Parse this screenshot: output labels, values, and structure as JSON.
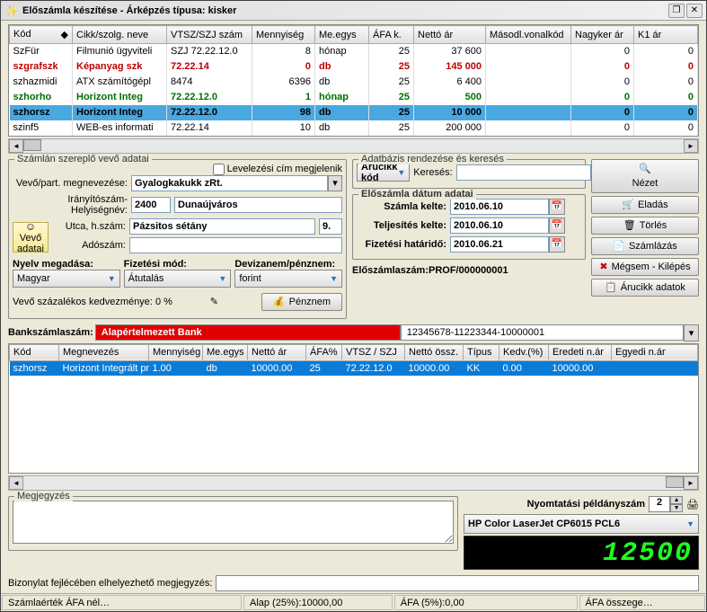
{
  "window": {
    "title": "Előszámla készítése - Árképzés típusa: kisker"
  },
  "grid1": {
    "cols": [
      "Kód",
      "Cikk/szolg. neve",
      "VTSZ/SZJ szám",
      "Mennyiség",
      "Me.egys",
      "ÁFA k.",
      "Nettó ár",
      "Másodl.vonalkód",
      "Nagyker ár",
      "K1 ár"
    ],
    "rows": [
      {
        "c": [
          "SzFür",
          "Filmunió ügyviteli",
          "SZJ 72.22.12.0",
          "8",
          "hónap",
          "25",
          "37 600",
          "",
          "0",
          "0"
        ],
        "cls": ""
      },
      {
        "c": [
          "szgrafszk",
          "Képanyag szk",
          "72.22.14",
          "0",
          "db",
          "25",
          "145 000",
          "",
          "0",
          "0"
        ],
        "cls": "red"
      },
      {
        "c": [
          "szhazmidi",
          "ATX számítógépl",
          "8474",
          "6396",
          "db",
          "25",
          "6 400",
          "",
          "0",
          "0"
        ],
        "cls": ""
      },
      {
        "c": [
          "szhorho",
          "Horizont Integ",
          "72.22.12.0",
          "1",
          "hónap",
          "25",
          "500",
          "",
          "0",
          "0"
        ],
        "cls": "green"
      },
      {
        "c": [
          "szhorsz",
          "Horizont Integ",
          "72.22.12.0",
          "98",
          "db",
          "25",
          "10 000",
          "",
          "0",
          "0"
        ],
        "cls": "sel"
      },
      {
        "c": [
          "szinf5",
          "WEB-es informati",
          "72.22.14",
          "10",
          "db",
          "25",
          "200 000",
          "",
          "0",
          "0"
        ],
        "cls": ""
      }
    ]
  },
  "buyer": {
    "legend": "Számlán szereplő vevő adatai",
    "mail_chk": "Levelezési cím megjelenik",
    "l_name": "Vevő/part. megnevezése:",
    "name": "Gyalogkakukk zRt.",
    "l_zip": "Irányítószám-Helyiségnév:",
    "zip": "2400",
    "city": "Dunaújváros",
    "l_street": "Utca, h.szám:",
    "street": "Pázsitos sétány",
    "house": "9.",
    "l_tax": "Adószám:",
    "btn_vevo1": "Vevő",
    "btn_vevo2": "adatai",
    "l_lang": "Nyelv megadása:",
    "lang": "Magyar",
    "l_pay": "Fizetési mód:",
    "pay": "Átutalás",
    "l_curr": "Devizanem/pénznem:",
    "curr": "forint",
    "l_disc": "Vevő százalékos kedvezménye: 0 %",
    "btn_penznem": "Pénznem"
  },
  "db": {
    "legend": "Adatbázis rendezése és keresés",
    "sort": "Árucikk kód",
    "l_search": "Keresés:"
  },
  "dates": {
    "legend": "Előszámla dátum adatai",
    "l_kelte": "Számla kelte:",
    "kelte": "2010.06.10",
    "l_telj": "Teljesítés kelte:",
    "telj": "2010.06.10",
    "l_hat": "Fizetési határidő:",
    "hat": "2010.06.21"
  },
  "inv_no_lbl": "Előszámlaszám:",
  "inv_no": "PROF/000000001",
  "btns": {
    "nezet": "Nézet",
    "eladas": "Eladás",
    "torles": "Törlés",
    "szamlazas": "Számlázás",
    "megsem": "Mégsem - Kilépés",
    "arucikk": "Árucikk adatok"
  },
  "bank": {
    "lbl": "Bankszámlaszám:",
    "name": "Alapértelmezett Bank",
    "acct": "12345678-11223344-10000001"
  },
  "grid2": {
    "cols": [
      "Kód",
      "Megnevezés",
      "Mennyiség",
      "Me.egys",
      "Nettó ár",
      "ÁFA%",
      "VTSZ / SZJ",
      "Nettó össz.",
      "Típus",
      "Kedv.(%)",
      "Eredeti n.ár",
      "Egyedi n.ár"
    ],
    "row": [
      "szhorsz",
      "Horizont Integrált pr",
      "1.00",
      "db",
      "10000.00",
      "25",
      "72.22.12.0",
      "10000.00",
      "KK",
      "0.00",
      "10000.00",
      ""
    ]
  },
  "note_legend": "Megjegyzés",
  "copies_lbl": "Nyomtatási példányszám",
  "copies": "2",
  "printer": "HP Color LaserJet CP6015 PCL6",
  "lcd": "12500",
  "footnote_lbl": "Bizonylat fejlécében elhelyezhető megjegyzés:",
  "status": {
    "s1": "Számlaérték ÁFA nél…",
    "s2": "Alap (25%):10000,00",
    "s3": "ÁFA (5%):0,00",
    "s4": "ÁFA összege…"
  }
}
